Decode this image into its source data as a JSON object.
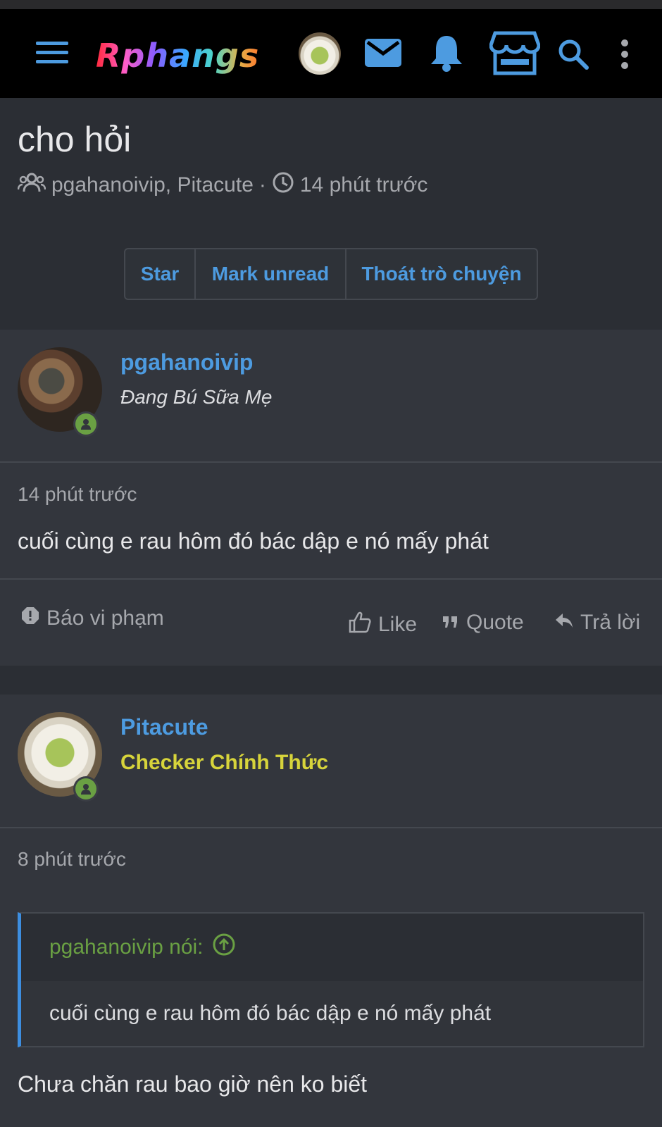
{
  "app": {
    "logo_text": "Rphangs",
    "colors": {
      "background": "#2b2e34",
      "topbar": "#000000",
      "accent": "#4d9be0",
      "online": "#6aa043",
      "rank_yellow": "#d7d43b"
    }
  },
  "topbar": {
    "icons": [
      "menu-icon",
      "avatar",
      "mail-icon",
      "bell-icon",
      "store-icon",
      "search-icon",
      "more-vertical-icon"
    ]
  },
  "thread": {
    "title": "cho hỏi",
    "participants": "pgahanoivip, Pitacute",
    "separator": "·",
    "time": "14 phút trước",
    "buttons": {
      "star": "Star",
      "mark_unread": "Mark unread",
      "leave": "Thoát trò chuyện"
    }
  },
  "messages": [
    {
      "username": "pgahanoivip",
      "user_title": "Đang Bú Sữa Mẹ",
      "time": "14 phút trước",
      "body": "cuối cùng e rau hôm đó bác dập e nó mấy phát",
      "actions": {
        "report": "Báo vi phạm",
        "like": "Like",
        "quote": "Quote",
        "reply": "Trả lời"
      }
    },
    {
      "username": "Pitacute",
      "user_title": "Checker Chính Thức",
      "time": "8 phút trước",
      "quote_author": "pgahanoivip nói:",
      "quote_body": "cuối cùng e rau hôm đó bác dập e nó mấy phát",
      "body": "Chưa chăn rau bao giờ nên ko biết"
    }
  ]
}
